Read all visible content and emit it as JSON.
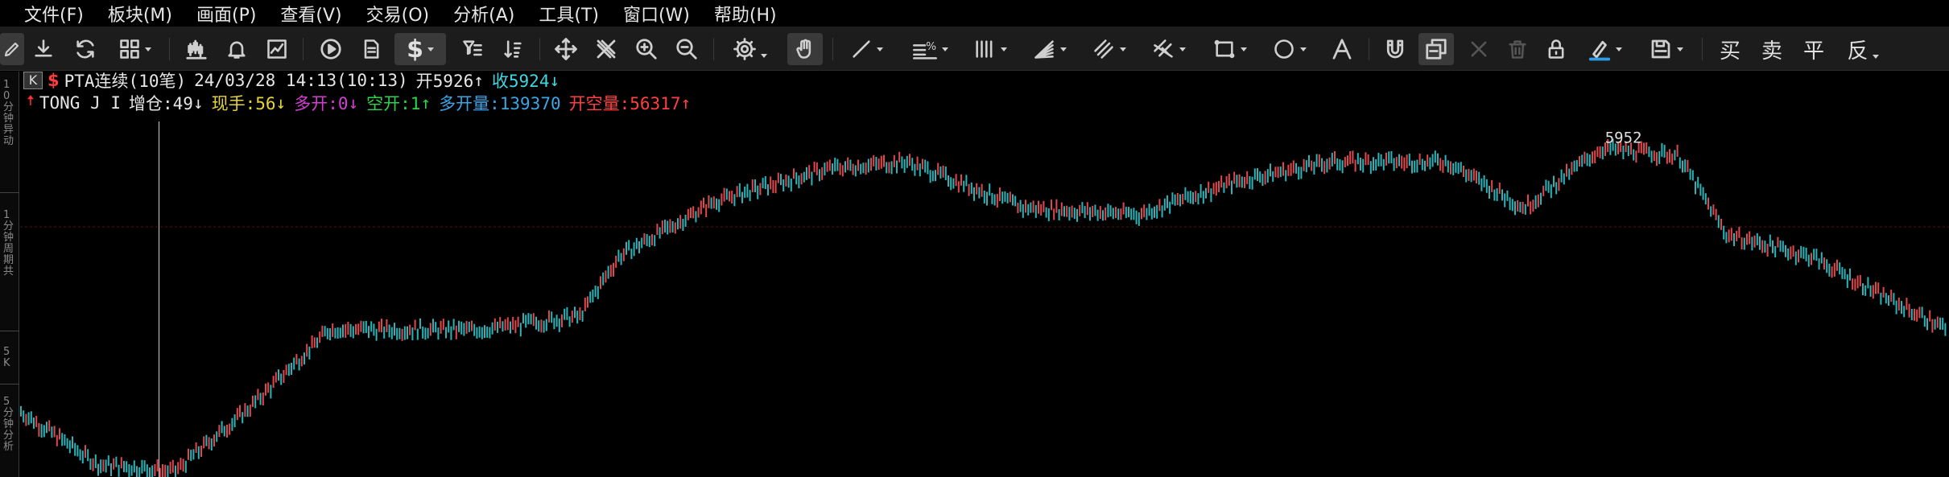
{
  "menu": [
    {
      "label": "文件(F)"
    },
    {
      "label": "板块(M)"
    },
    {
      "label": "画面(P)"
    },
    {
      "label": "查看(V)"
    },
    {
      "label": "交易(O)"
    },
    {
      "label": "分析(A)"
    },
    {
      "label": "工具(T)"
    },
    {
      "label": "窗口(W)"
    },
    {
      "label": "帮助(H)"
    }
  ],
  "toolbar": {
    "icons": [
      "pencil-icon",
      "download-icon",
      "refresh-icon",
      "layout-grid-icon",
      "candlestick-icon",
      "bell-icon",
      "chart-area-icon",
      "play-icon",
      "document-icon",
      "dollar-icon",
      "filter-icon",
      "sort-icon",
      "move-icon",
      "crosshair-icon",
      "zoom-in-icon",
      "zoom-out-icon",
      "settings-icon",
      "hand-icon",
      "line-tool-icon",
      "percent-lines-icon",
      "vertical-lines-icon",
      "fan-icon",
      "parallel-channel-icon",
      "pitchfork-icon",
      "rectangle-icon",
      "ellipse-icon",
      "text-tool-icon",
      "magnet-icon",
      "layers-icon",
      "close-icon",
      "trash-icon",
      "lock-icon",
      "color-pen-icon",
      "save-icon"
    ],
    "trade_buttons": [
      "买",
      "卖",
      "平",
      "反"
    ]
  },
  "left_ruler": {
    "labels": [
      "10分钟异动",
      "1分钟周期共",
      "5K",
      "5分钟分析"
    ]
  },
  "info_line1": {
    "k_box": "K",
    "dollar": "$",
    "symbol": "PTA连续(10笔)",
    "datetime": "24/03/28 14:13(10:13)",
    "open_label": "开5926",
    "open_arrow": "↑",
    "close_label": "收5924",
    "close_arrow": "↓"
  },
  "info_line2": {
    "name": "TONG J I",
    "zengcang": "增仓:49",
    "zengcang_arrow": "↓",
    "xianshou": "现手:56",
    "xianshou_arrow": "↓",
    "duokai": "多开:0",
    "duokai_arrow": "↓",
    "kongkai": "空开:1",
    "kongkai_arrow": "↑",
    "duokailiang": "多开量:139370",
    "kongkailiang": "开空量:56317",
    "kongkailiang_arrow": "↑"
  },
  "colors": {
    "up": "#e0484e",
    "down": "#2ab3b8",
    "yellow": "#e6d43a",
    "magenta": "#d23fd2",
    "green": "#2fd24a",
    "blue": "#3aa6e8",
    "red": "#ff4040",
    "cyan": "#3fd8e0"
  },
  "chart_data": {
    "type": "candlestick",
    "title": "",
    "annotations": [
      {
        "text": "5952",
        "kind": "high-marker"
      }
    ],
    "y_axis_visible": false,
    "grid": false,
    "series_shape_notes": "Renko-like brick bars; price rises from ~5860 at left to a high of 5952, then falls toward the right",
    "anchor_points": [
      {
        "x": 0,
        "price": 5868
      },
      {
        "x": 0.04,
        "price": 5852
      },
      {
        "x": 0.08,
        "price": 5850
      },
      {
        "x": 0.12,
        "price": 5870
      },
      {
        "x": 0.16,
        "price": 5893
      },
      {
        "x": 0.24,
        "price": 5893
      },
      {
        "x": 0.29,
        "price": 5897
      },
      {
        "x": 0.31,
        "price": 5915
      },
      {
        "x": 0.36,
        "price": 5932
      },
      {
        "x": 0.42,
        "price": 5942
      },
      {
        "x": 0.46,
        "price": 5944
      },
      {
        "x": 0.52,
        "price": 5930
      },
      {
        "x": 0.58,
        "price": 5928
      },
      {
        "x": 0.63,
        "price": 5938
      },
      {
        "x": 0.68,
        "price": 5944
      },
      {
        "x": 0.74,
        "price": 5944
      },
      {
        "x": 0.78,
        "price": 5930
      },
      {
        "x": 0.82,
        "price": 5948
      },
      {
        "x": 0.86,
        "price": 5946
      },
      {
        "x": 0.885,
        "price": 5922
      },
      {
        "x": 0.93,
        "price": 5915
      },
      {
        "x": 0.97,
        "price": 5902
      },
      {
        "x": 1.0,
        "price": 5893
      }
    ],
    "price_range": [
      5848,
      5956
    ],
    "crosshair_fraction": 0.072,
    "reference_price": 5924
  }
}
